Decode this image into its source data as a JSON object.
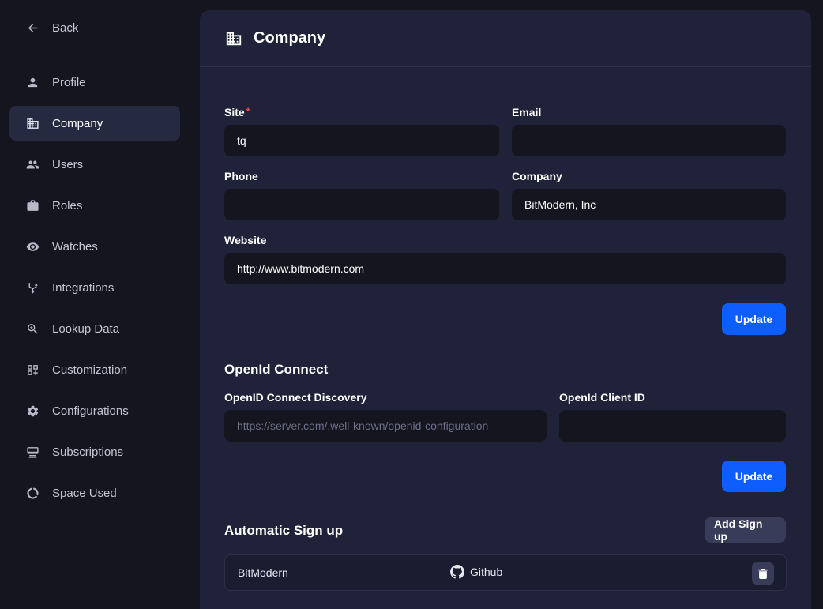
{
  "sidebar": {
    "back_label": "Back",
    "items": [
      {
        "label": "Profile",
        "icon": "person-icon"
      },
      {
        "label": "Company",
        "icon": "building-icon",
        "active": true
      },
      {
        "label": "Users",
        "icon": "users-icon"
      },
      {
        "label": "Roles",
        "icon": "briefcase-icon"
      },
      {
        "label": "Watches",
        "icon": "eye-icon"
      },
      {
        "label": "Integrations",
        "icon": "integrations-icon"
      },
      {
        "label": "Lookup Data",
        "icon": "search-zoom-icon"
      },
      {
        "label": "Customization",
        "icon": "widgets-icon"
      },
      {
        "label": "Configurations",
        "icon": "gear-icon"
      },
      {
        "label": "Subscriptions",
        "icon": "subscriptions-icon"
      },
      {
        "label": "Space Used",
        "icon": "donut-icon"
      }
    ]
  },
  "header": {
    "title": "Company",
    "icon": "building-icon"
  },
  "company_form": {
    "site_label": "Site",
    "site_required": "*",
    "site_value": "tq",
    "email_label": "Email",
    "email_value": "",
    "phone_label": "Phone",
    "phone_value": "",
    "company_label": "Company",
    "company_value": "BitModern, Inc",
    "website_label": "Website",
    "website_value": "http://www.bitmodern.com",
    "update_label": "Update"
  },
  "openid": {
    "title": "OpenId Connect",
    "discovery_label": "OpenID Connect Discovery",
    "discovery_placeholder": "https://server.com/.well-known/openid-configuration",
    "client_id_label": "OpenId Client ID",
    "client_id_value": "",
    "update_label": "Update"
  },
  "auto_signup": {
    "title": "Automatic Sign up",
    "add_label": "Add Sign up",
    "rows": [
      {
        "name": "BitModern",
        "provider": "Github",
        "provider_icon": "github-icon"
      }
    ]
  },
  "colors": {
    "accent": "#0d5efc",
    "panel": "#1f2238",
    "background": "#15151f",
    "required": "#ff4d4f"
  }
}
